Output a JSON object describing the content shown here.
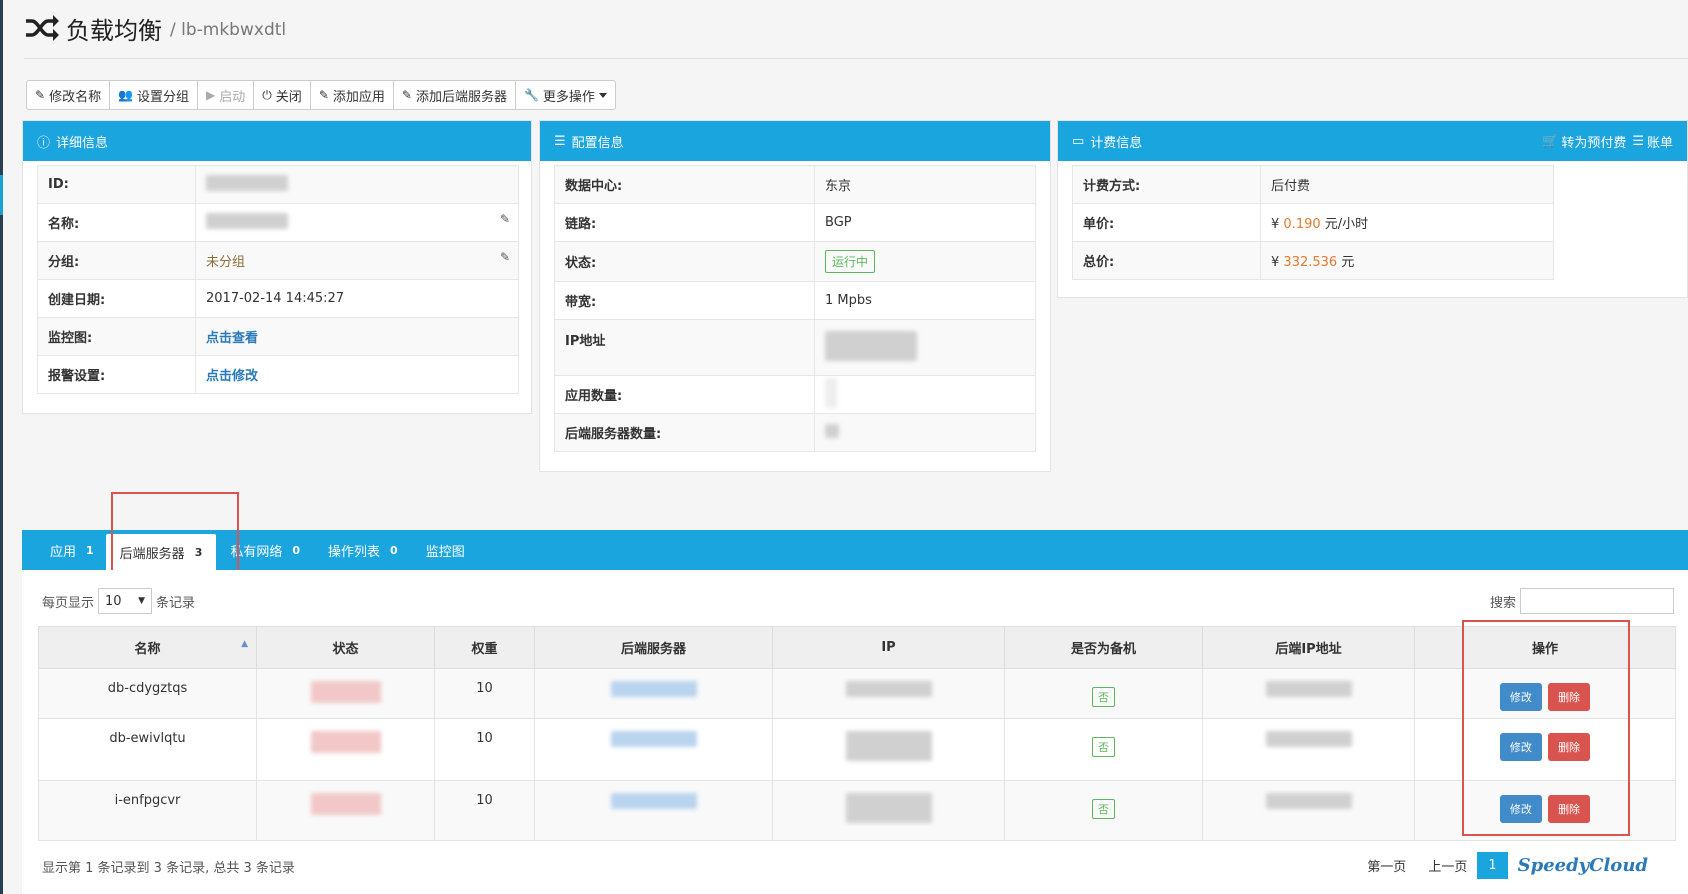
{
  "header": {
    "title": "负载均衡",
    "subtitle": "/ lb-mkbwxdtl"
  },
  "toolbar": {
    "buttons": [
      {
        "label": "修改名称",
        "icon": "edit-icon"
      },
      {
        "label": "设置分组",
        "icon": "users-icon"
      },
      {
        "label": "启动",
        "icon": "play-icon"
      },
      {
        "label": "关闭",
        "icon": "power-icon"
      },
      {
        "label": "添加应用",
        "icon": "edit-icon"
      },
      {
        "label": "添加后端服务器",
        "icon": "edit-icon"
      },
      {
        "label": "更多操作",
        "icon": "wrench-icon"
      }
    ]
  },
  "detail": {
    "title": "详细信息",
    "rows": [
      {
        "key": "ID:",
        "value": ""
      },
      {
        "key": "名称:",
        "value": ""
      },
      {
        "key": "分组:",
        "value": "未分组"
      },
      {
        "key": "创建日期:",
        "value": "2017-02-14 14:45:27"
      },
      {
        "key": "监控图:",
        "value": "点击查看"
      },
      {
        "key": "报警设置:",
        "value": "点击修改"
      }
    ]
  },
  "config": {
    "title": "配置信息",
    "rows": [
      {
        "key": "数据中心:",
        "value": "东京"
      },
      {
        "key": "链路:",
        "value": "BGP"
      },
      {
        "key": "状态:",
        "value": "运行中"
      },
      {
        "key": "带宽:",
        "value": "1 Mpbs"
      },
      {
        "key": "IP地址",
        "value": ""
      },
      {
        "key": "应用数量:",
        "value": ""
      },
      {
        "key": "后端服务器数量:",
        "value": ""
      }
    ]
  },
  "billing": {
    "title": "计费信息",
    "prepay_label": "转为预付费",
    "bill_label": "账单",
    "rows": [
      {
        "key": "计费方式:",
        "value": "后付费"
      },
      {
        "key": "单价:",
        "currency": "¥",
        "amount": "0.190",
        "unit": "元/小时"
      },
      {
        "key": "总价:",
        "currency": "¥",
        "amount": "332.536",
        "unit": "元"
      }
    ]
  },
  "tabs": [
    {
      "label": "应用",
      "count": "1"
    },
    {
      "label": "后端服务器",
      "count": "3"
    },
    {
      "label": "私有网络",
      "count": "0"
    },
    {
      "label": "操作列表",
      "count": "0"
    },
    {
      "label": "监控图",
      "count": ""
    }
  ],
  "table_controls": {
    "length_prefix": "每页显示",
    "length_value": "10",
    "length_suffix": "条记录",
    "search_label": "搜索"
  },
  "table": {
    "columns": [
      "名称",
      "状态",
      "权重",
      "后端服务器",
      "IP",
      "是否为备机",
      "后端IP地址",
      "操作"
    ],
    "rows": [
      {
        "name": "db-cdygztqs",
        "weight": "10",
        "backup": "否"
      },
      {
        "name": "db-ewivlqtu",
        "weight": "10",
        "backup": "否"
      },
      {
        "name": "i-enfpgcvr",
        "weight": "10",
        "backup": "否"
      }
    ],
    "edit_label": "修改",
    "delete_label": "删除"
  },
  "footer": {
    "info": "显示第 1 条记录到 3 条记录, 总共 3 条记录",
    "first": "第一页",
    "prev": "上一页",
    "current": "1",
    "watermark": "SpeedyCloud"
  },
  "colors": {
    "accent": "#1ba5df",
    "highlight_box": "#d9534f",
    "edit_button": "#428bca",
    "delete_button": "#d9534f"
  }
}
